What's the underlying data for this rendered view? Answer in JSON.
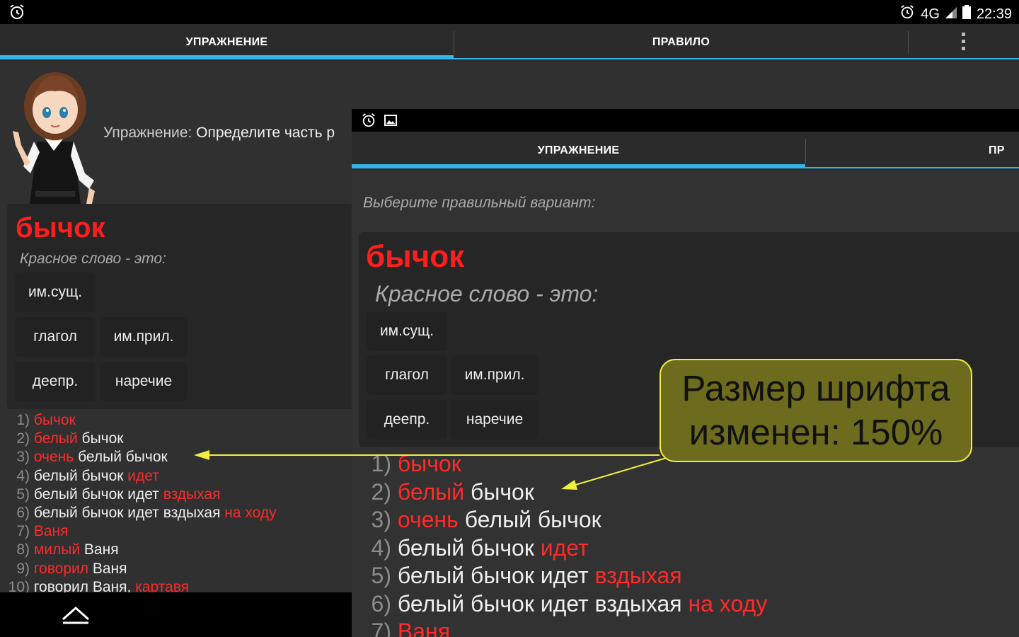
{
  "status_bar": {
    "network": "4G",
    "time": "22:39"
  },
  "tabs": [
    {
      "label": "УПРАЖНЕНИЕ",
      "selected": true
    },
    {
      "label": "ПРАВИЛО",
      "selected": false
    }
  ],
  "background_screen": {
    "exercise_prefix": "Упражнение:",
    "exercise_text": "Определите часть р",
    "word": "бычок",
    "prompt": "Красное слово - это:",
    "options": [
      "им.сущ.",
      "глагол",
      "им.прил.",
      "деепр.",
      "наречие"
    ],
    "list": [
      {
        "n": "1)",
        "red1": "бычок",
        "white": "",
        "red2": ""
      },
      {
        "n": "2)",
        "red1": "белый",
        "white": " бычок",
        "red2": ""
      },
      {
        "n": "3)",
        "red1": "очень",
        "white": " белый бычок",
        "red2": ""
      },
      {
        "n": "4)",
        "red1": "",
        "white": "белый бычок ",
        "red2": "идет"
      },
      {
        "n": "5)",
        "red1": "",
        "white": "белый бычок идет ",
        "red2": "вздыхая"
      },
      {
        "n": "6)",
        "red1": "",
        "white": "белый бычок идет вздыхая ",
        "red2": "на ходу"
      },
      {
        "n": "7)",
        "red1": "Ваня",
        "white": "",
        "red2": ""
      },
      {
        "n": "8)",
        "red1": "милый",
        "white": " Ваня",
        "red2": ""
      },
      {
        "n": "9)",
        "red1": "говорил",
        "white": " Ваня",
        "red2": ""
      },
      {
        "n": "10)",
        "red1": "",
        "white": "говорил Ваня, ",
        "red2": "картавя"
      }
    ]
  },
  "foreground_screen": {
    "tabs": [
      {
        "label": "УПРАЖНЕНИЕ",
        "selected": true
      },
      {
        "label": "ПР",
        "selected": false
      }
    ],
    "instruction": "Выберите правильный вариант:",
    "word": "бычок",
    "prompt": "Красное слово - это:",
    "options": [
      "им.сущ.",
      "глагол",
      "им.прил.",
      "деепр.",
      "наречие"
    ],
    "list": [
      {
        "n": "1)",
        "red1": "бычок",
        "white": "",
        "red2": ""
      },
      {
        "n": "2)",
        "red1": "белый",
        "white": " бычок",
        "red2": ""
      },
      {
        "n": "3)",
        "red1": "очень",
        "white": " белый бычок",
        "red2": ""
      },
      {
        "n": "4)",
        "red1": "",
        "white": "белый бычок ",
        "red2": "идет"
      },
      {
        "n": "5)",
        "red1": "",
        "white": "белый бычок идет ",
        "red2": "вздыхая"
      },
      {
        "n": "6)",
        "red1": "",
        "white": "белый бычок идет вздыхая ",
        "red2": "на ходу"
      },
      {
        "n": "7)",
        "red1": "Ваня",
        "white": "",
        "red2": ""
      }
    ]
  },
  "callout": {
    "line1": "Размер шрифта",
    "line2": "изменен: 150%"
  },
  "colors": {
    "accent": "#33b5e5",
    "highlight_red": "#ff1e1e",
    "callout_bg": "#6d6b1d",
    "callout_border": "#f0ef3e"
  }
}
